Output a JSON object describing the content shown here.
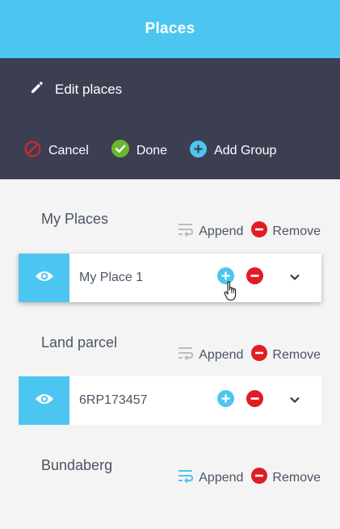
{
  "header": {
    "title": "Places"
  },
  "toolbar": {
    "edit_label": "Edit places",
    "cancel_label": "Cancel",
    "done_label": "Done",
    "add_group_label": "Add Group"
  },
  "groups": [
    {
      "name": "My Places",
      "append_label": "Append",
      "remove_label": "Remove",
      "places": [
        {
          "name": "My Place 1"
        }
      ]
    },
    {
      "name": "Land parcel",
      "append_label": "Append",
      "remove_label": "Remove",
      "places": [
        {
          "name": "6RP173457"
        }
      ]
    },
    {
      "name": "Bundaberg",
      "append_label": "Append",
      "remove_label": "Remove",
      "places": []
    }
  ],
  "colors": {
    "header": "#4cc6f0",
    "toolbar": "#3c3f52",
    "cancel": "#e0242f",
    "done": "#6ab82d",
    "add": "#4cc6f0",
    "remove": "#e01c24",
    "append_inactive": "#b8bcc4",
    "append_active": "#4cc6f0"
  },
  "icons": [
    "pencil-icon",
    "cancel-icon",
    "check-icon",
    "plus-icon",
    "append-icon",
    "minus-icon",
    "eye-icon",
    "chevron-down-icon",
    "hand-cursor-icon"
  ]
}
